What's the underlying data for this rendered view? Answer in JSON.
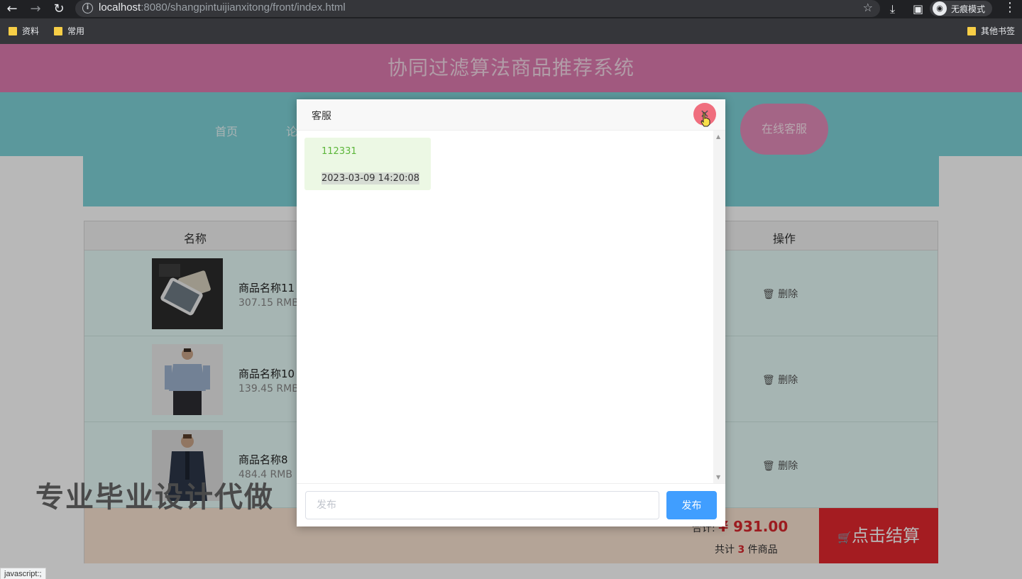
{
  "browser": {
    "url_host": "localhost",
    "url_rest": ":8080/shangpintuijianxitong/front/index.html",
    "incognito_label": "无痕模式",
    "bookmarks": [
      "资料",
      "常用"
    ],
    "other_bookmarks": "其他书签"
  },
  "site": {
    "title": "协同过滤算法商品推荐系统",
    "nav": [
      "首页",
      "论"
    ],
    "chat_button": "在线客服"
  },
  "cart": {
    "col_name": "名称",
    "col_op": "操作",
    "rows": [
      {
        "name": "商品名称11",
        "price": "307.15 RMB",
        "delete": "删除"
      },
      {
        "name": "商品名称10",
        "price": "139.45 RMB",
        "delete": "删除"
      },
      {
        "name": "商品名称8",
        "price": "484.4 RMB",
        "delete": "删除"
      }
    ],
    "total_label": "合计:",
    "total_currency": "¥",
    "total_amount": "931.00",
    "count_prefix": "共计",
    "count": "3",
    "count_suffix": "件商品",
    "checkout": "点击结算"
  },
  "watermark": "专业毕业设计代做",
  "dialog": {
    "title": "客服",
    "close": "✕",
    "message": {
      "text": "112331",
      "time": "2023-03-09 14:20:08"
    },
    "input_placeholder": "发布",
    "send_label": "发布"
  },
  "status_bar": "javascript:;",
  "colors": {
    "header_pink": "#e07cb0",
    "nav_teal": "#7ed3d8",
    "send_blue": "#409eff",
    "checkout_red": "#e3282e",
    "price_red": "#d8272d"
  }
}
